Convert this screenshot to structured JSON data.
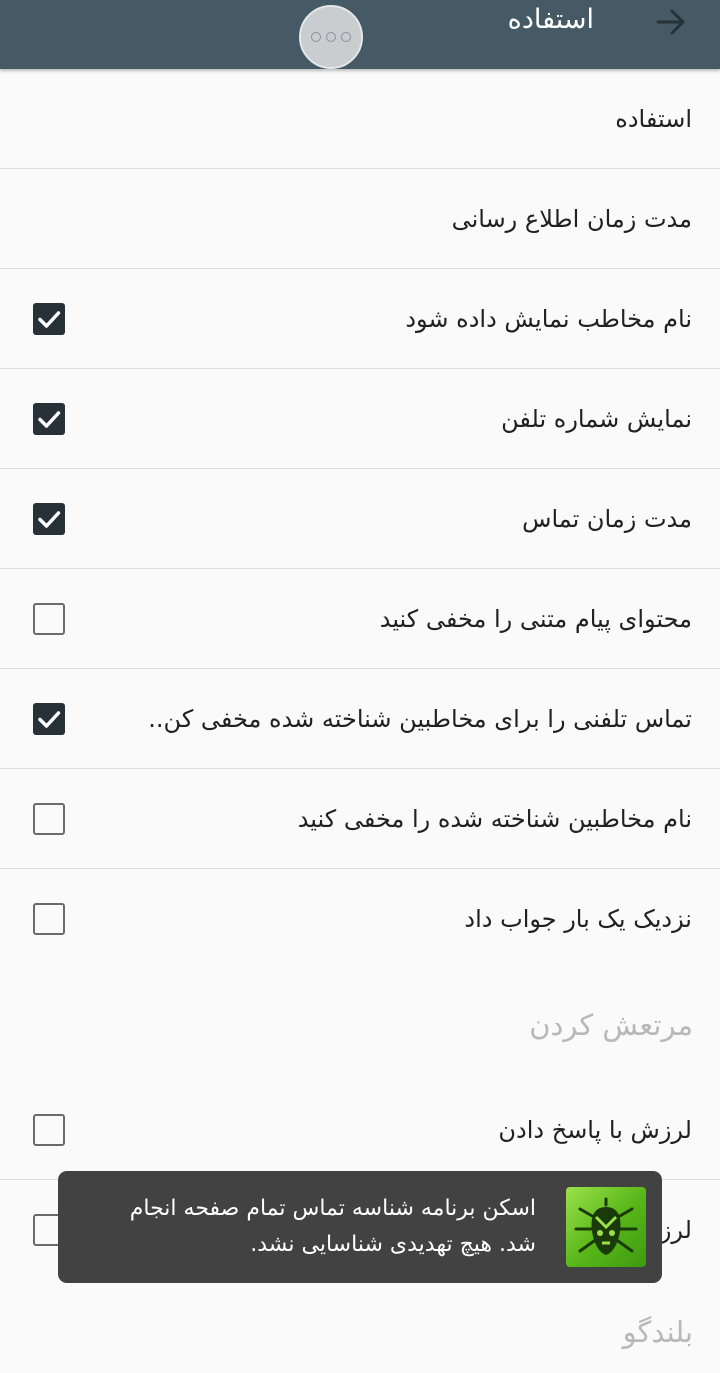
{
  "toolbar": {
    "title": "استفاده",
    "back_icon": "arrow-right-icon",
    "background": "#455a64"
  },
  "floating_button": {
    "icon": "three-dots-icon"
  },
  "rows_top": [
    {
      "label": "استفاده"
    },
    {
      "label": "مدت زمان اطلاع رسانی"
    }
  ],
  "checkbox_rows": [
    {
      "label": "نام مخاطب نمایش داده شود",
      "checked": true
    },
    {
      "label": "نمایش شماره تلفن",
      "checked": true
    },
    {
      "label": "مدت زمان تماس",
      "checked": true
    },
    {
      "label": "محتوای پیام متنی را مخفی کنید",
      "checked": false
    },
    {
      "label": "تماس تلفنی را برای مخاطبین شناخته شده مخفی کن..",
      "checked": true
    },
    {
      "label": "نام مخاطبین شناخته شده را مخفی کنید",
      "checked": false
    },
    {
      "label": "نزدیک یک بار جواب داد",
      "checked": false
    }
  ],
  "vibrate_section": {
    "title": "مرتعش کردن",
    "rows": [
      {
        "label": "لرزش با پاسخ دادن",
        "checked": false
      },
      {
        "label": "لرز",
        "checked": false
      }
    ]
  },
  "speaker_section": {
    "title": "بلندگو"
  },
  "toast": {
    "text": "اسکن برنامه شناسه تماس تمام صفحه انجام شد. هیچ تهدیدی شناسایی نشد.",
    "icon": "dr-web-spider-icon",
    "icon_color": "#6cc52a"
  },
  "colors": {
    "checkbox_checked": "#263238",
    "section_title": "#b8b8b8",
    "toast_bg": "#424242"
  }
}
